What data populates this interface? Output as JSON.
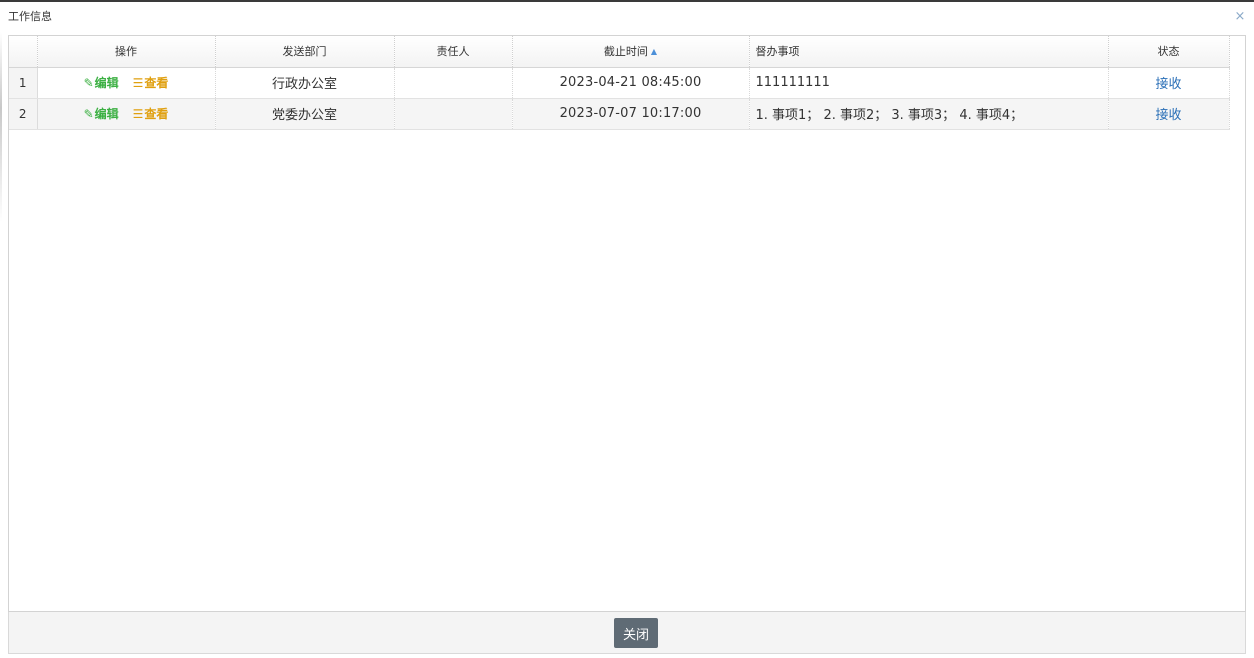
{
  "window": {
    "title": "工作信息",
    "close_glyph": "×"
  },
  "grid": {
    "columns": [
      {
        "label": ""
      },
      {
        "label": "操作"
      },
      {
        "label": "发送部门"
      },
      {
        "label": "责任人"
      },
      {
        "label": "截止时间",
        "sort": "ascending"
      },
      {
        "label": "督办事项"
      },
      {
        "label": "状态"
      }
    ],
    "rows": [
      {
        "num": "1",
        "edit_label": "编辑",
        "view_label": "查看",
        "dept": "行政办公室",
        "owner": "",
        "deadline": "2023-04-21 08:45:00",
        "items": "111111111",
        "status": "接收"
      },
      {
        "num": "2",
        "edit_label": "编辑",
        "view_label": "查看",
        "dept": "党委办公室",
        "owner": "",
        "deadline": "2023-07-07 10:17:00",
        "items": "1. 事项1；  2. 事项2；  3. 事项3；  4. 事项4；",
        "status": "接收"
      }
    ]
  },
  "icons": {
    "edit": "edit-icon",
    "view": "list-icon",
    "sort": "sort-up-icon",
    "close": "close-icon"
  },
  "colors": {
    "edit_action": "#3cb043",
    "view_action": "#e0a010",
    "status_link": "#2a6fb7",
    "sort_icon": "#4d90d8",
    "close_button_bg": "#5f6b75"
  },
  "footer": {
    "close_label": "关闭"
  }
}
